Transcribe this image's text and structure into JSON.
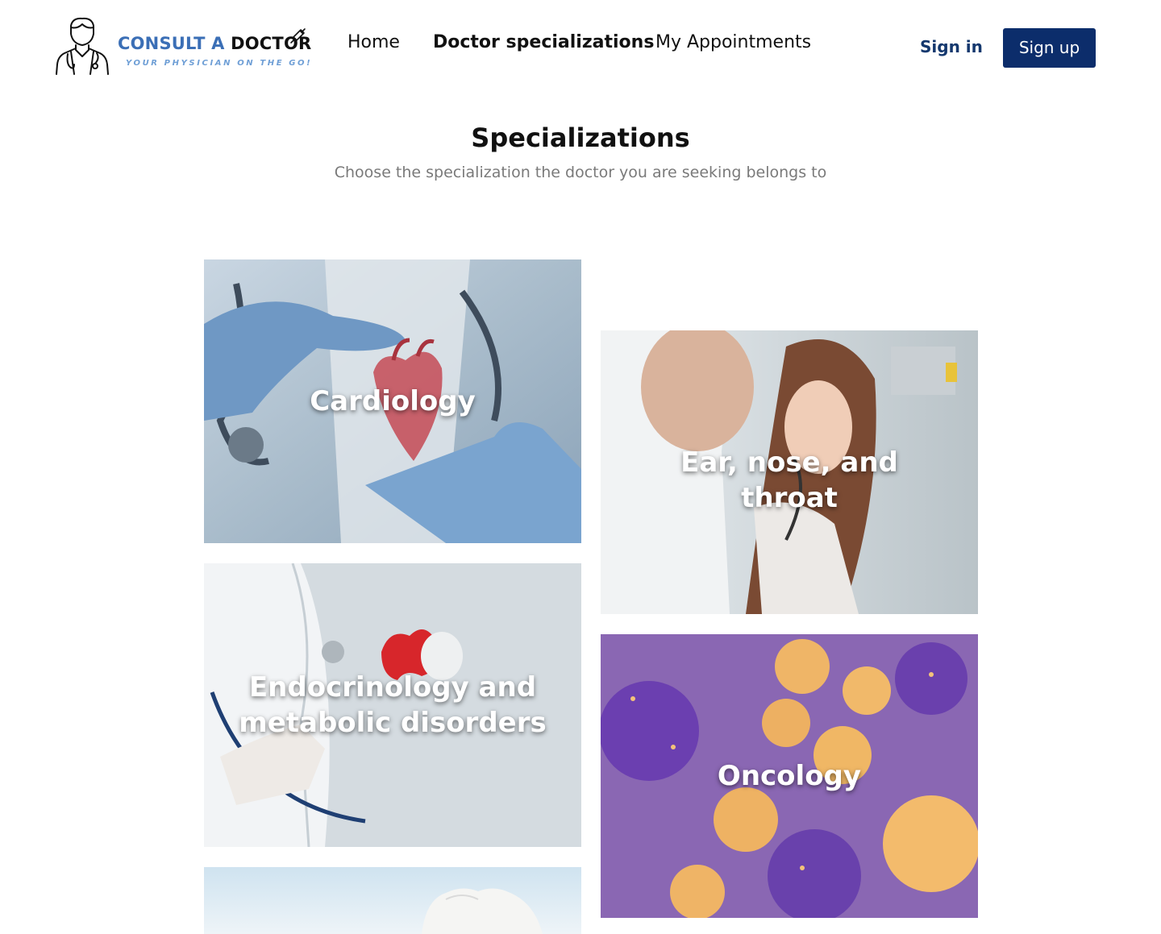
{
  "brand": {
    "name_part1": "CONSULT A ",
    "name_part2": "DOCTOR",
    "tagline": "YOUR PHYSICIAN ON THE GO!"
  },
  "nav": {
    "home": "Home",
    "specializations": "Doctor specializations",
    "appointments": "My Appointments"
  },
  "auth": {
    "sign_in": "Sign in",
    "sign_up": "Sign up"
  },
  "page": {
    "title": "Specializations",
    "subtitle": "Choose the specialization the doctor you are seeking belongs to"
  },
  "specializations": [
    {
      "label": "Cardiology",
      "image": "heart-model-held-by-gloved-hands"
    },
    {
      "label": "Ear, nose, and throat",
      "image": "doctor-examining-girl-ear"
    },
    {
      "label": "Endocrinology and metabolic disorders",
      "image": "doctor-with-stethoscope-holding-thyroid-model"
    },
    {
      "label": "Oncology",
      "image": "cancer-cells-illustration"
    },
    {
      "label": "",
      "image": "tooth-model"
    }
  ],
  "colors": {
    "primary": "#0c2d6b",
    "sign_in_text": "#14386e",
    "brand_blue": "#3b6fb6",
    "subtitle_gray": "#7a7a7a"
  }
}
